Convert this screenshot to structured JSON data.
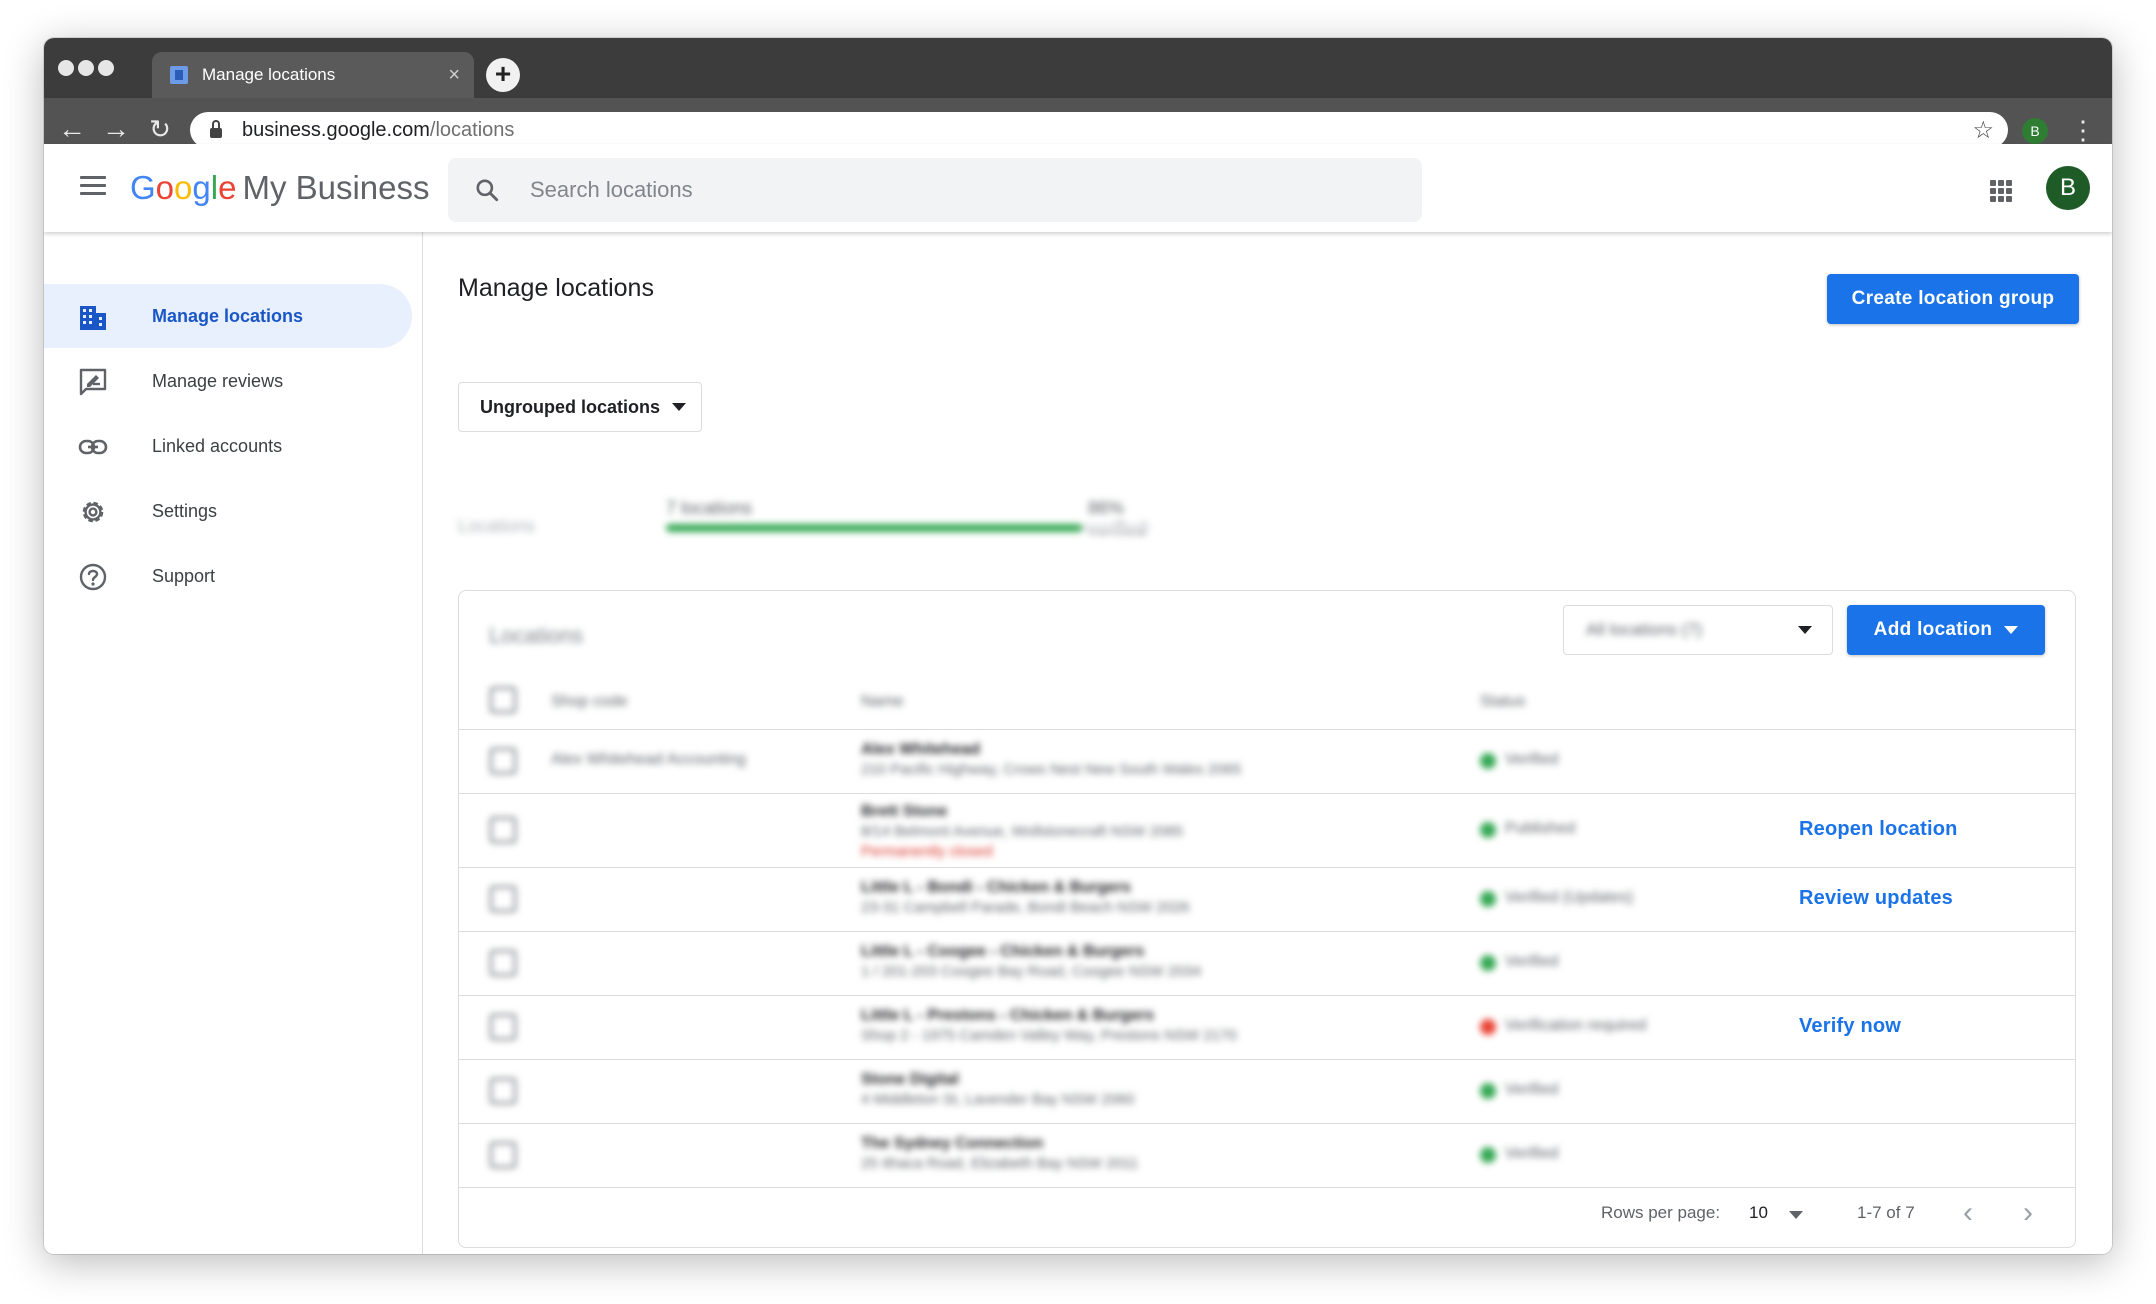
{
  "browser": {
    "tab_title": "Manage locations",
    "tab_close": "×",
    "new_tab": "+",
    "url_host": "business.google.com",
    "url_path": "/locations",
    "profile_initial": "B"
  },
  "app": {
    "logo_letters": [
      "G",
      "o",
      "o",
      "g",
      "l",
      "e"
    ],
    "product_name": "My Business",
    "search_placeholder": "Search locations",
    "avatar_initial": "B"
  },
  "sidebar": {
    "items": [
      {
        "label": "Manage locations",
        "icon": "building-icon",
        "active": true
      },
      {
        "label": "Manage reviews",
        "icon": "review-icon",
        "active": false
      },
      {
        "label": "Linked accounts",
        "icon": "link-icon",
        "active": false
      },
      {
        "label": "Settings",
        "icon": "gear-icon",
        "active": false
      },
      {
        "label": "Support",
        "icon": "help-icon",
        "active": false
      }
    ]
  },
  "main": {
    "title": "Manage locations",
    "create_group_label": "Create location group",
    "group_dropdown_label": "Ungrouped locations",
    "stats": {
      "label": "Locations",
      "count_text": "7 locations",
      "verified_text": "86% verified",
      "verified_fraction": 0.86
    },
    "card": {
      "title": "Locations",
      "filter_label": "All locations (7)",
      "add_location_label": "Add location",
      "columns": {
        "store_code": "Shop code",
        "name": "Name",
        "status": "Status"
      },
      "rows": [
        {
          "store": "Alex Whitehead Accounting",
          "name": "Alex Whitehead",
          "address": "210 Pacific Highway, Crows Nest New South Wales 2065",
          "closed": "",
          "status": "Verified",
          "status_color": "#34a853",
          "action": ""
        },
        {
          "store": "",
          "name": "Brett Stone",
          "address": "8/14 Belmont Avenue, Wollstonecraft NSW 2065",
          "closed": "Permanently closed",
          "status": "Published",
          "status_color": "#34a853",
          "action": "Reopen location"
        },
        {
          "store": "",
          "name": "Little L - Bondi - Chicken & Burgers",
          "address": "23-31 Campbell Parade, Bondi Beach NSW 2026",
          "closed": "",
          "status": "Verified (Updates)",
          "status_color": "#34a853",
          "action": "Review updates"
        },
        {
          "store": "",
          "name": "Little L - Coogee - Chicken & Burgers",
          "address": "1 / 201-203 Coogee Bay Road, Coogee NSW 2034",
          "closed": "",
          "status": "Verified",
          "status_color": "#34a853",
          "action": ""
        },
        {
          "store": "",
          "name": "Little L - Prestons - Chicken & Burgers",
          "address": "Shop 2 - 1975 Camden Valley Way, Prestons NSW 2170",
          "closed": "",
          "status": "Verification required",
          "status_color": "#ea4335",
          "action": "Verify now"
        },
        {
          "store": "",
          "name": "Stone Digital",
          "address": "4 Middleton St, Lavender Bay NSW 2060",
          "closed": "",
          "status": "Verified",
          "status_color": "#34a853",
          "action": ""
        },
        {
          "store": "",
          "name": "The Sydney Connection",
          "address": "25 Ithaca Road, Elizabeth Bay NSW 2011",
          "closed": "",
          "status": "Verified",
          "status_color": "#34a853",
          "action": ""
        }
      ]
    },
    "pagination": {
      "rows_per_page_label": "Rows per page:",
      "rows_per_page_value": "10",
      "range": "1-7 of 7",
      "prev": "‹",
      "next": "›"
    }
  }
}
